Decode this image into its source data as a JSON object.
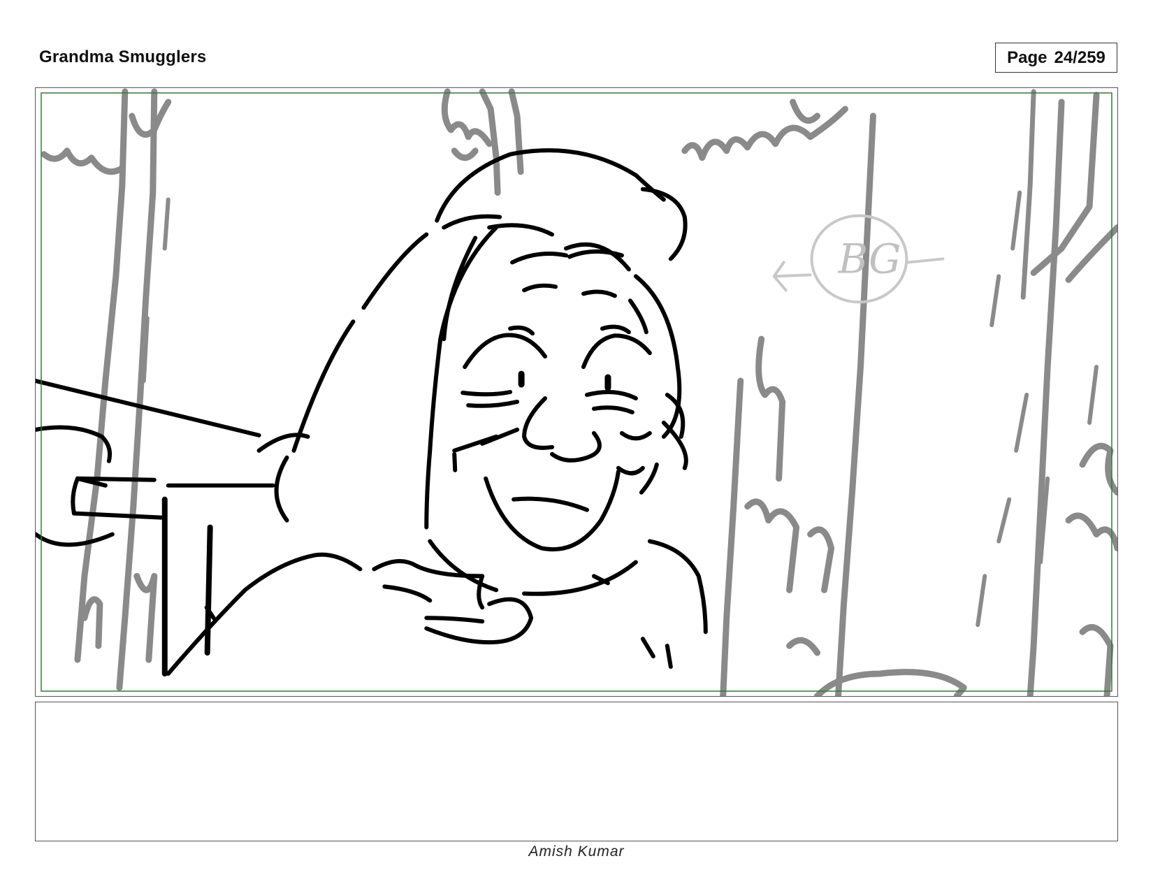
{
  "header": {
    "project_title": "Grandma Smugglers",
    "page_label": "Page",
    "page_number": "24/259"
  },
  "panel": {
    "safe_area_color": "#2e7d32",
    "watermark_text": "BG"
  },
  "notes": {
    "text": ""
  },
  "footer": {
    "author": "Amish Kumar"
  }
}
